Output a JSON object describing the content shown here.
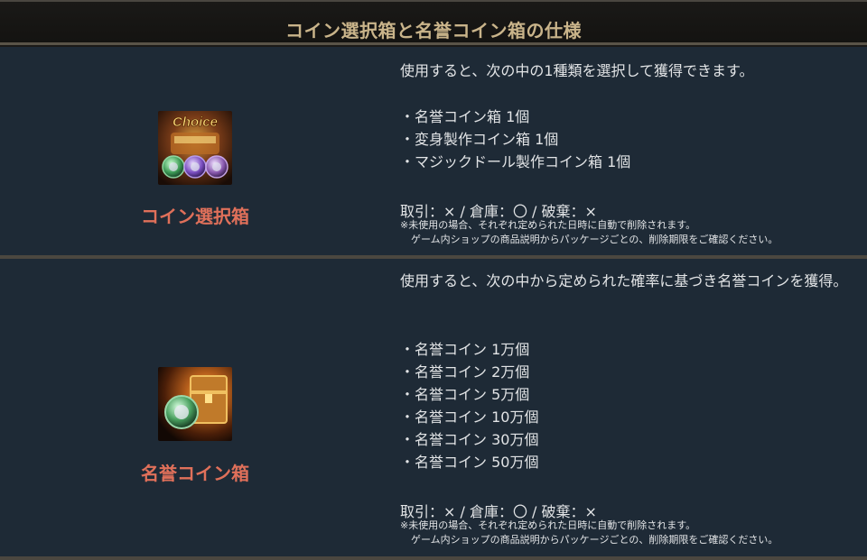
{
  "header": {
    "title": "コイン選択箱と名誉コイン箱の仕様"
  },
  "items": [
    {
      "name": "コイン選択箱",
      "icon": "coin-choice-box-icon",
      "icon_badge": "Choice",
      "description": "使用すると、次の中の1種類を選択して獲得できます。",
      "bullets": [
        "・名誉コイン箱 1個",
        "・変身製作コイン箱 1個",
        "・マジックドール製作コイン箱 1個"
      ],
      "trade": "取引：× / 倉庫：〇 / 破棄：×",
      "note_line1": "※未使用の場合、それぞれ定められた日時に自動で削除されます。",
      "note_line2": "ゲーム内ショップの商品説明からパッケージごとの、削除期限をご確認ください。"
    },
    {
      "name": "名誉コイン箱",
      "icon": "honor-coin-box-icon",
      "description": "使用すると、次の中から定められた確率に基づき名誉コインを獲得。",
      "bullets": [
        "・名誉コイン 1万個",
        "・名誉コイン 2万個",
        "・名誉コイン 5万個",
        "・名誉コイン 10万個",
        "・名誉コイン 30万個",
        "・名誉コイン 50万個"
      ],
      "trade": "取引：× / 倉庫：〇 / 破棄：×",
      "note_line1": "※未使用の場合、それぞれ定められた日時に自動で削除されます。",
      "note_line2": "ゲーム内ショップの商品説明からパッケージごとの、削除期限をご確認ください。"
    }
  ],
  "colors": {
    "title": "#c9b48a",
    "item_name": "#e0705a",
    "row_bg": "#1e2a36"
  }
}
